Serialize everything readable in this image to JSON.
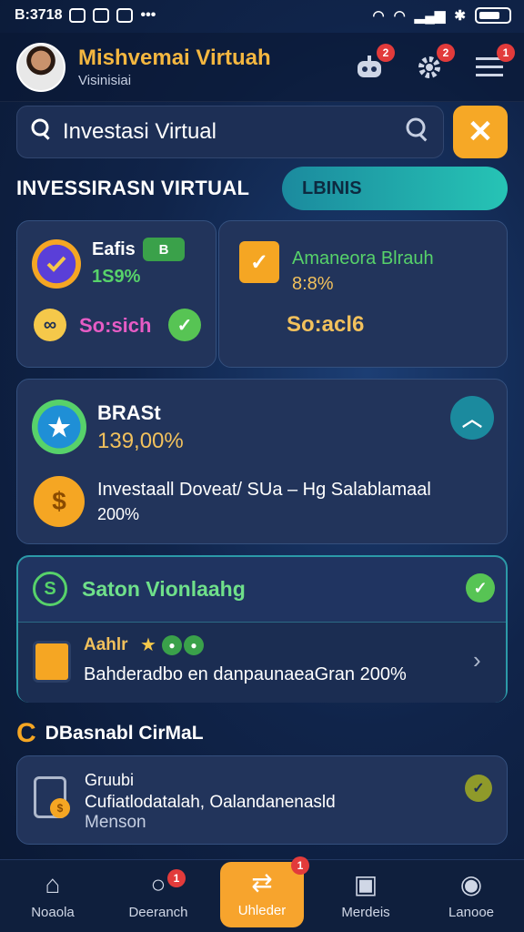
{
  "status_bar": {
    "time": "B:3718",
    "dots": "•••"
  },
  "header": {
    "title": "Mishvemai Virtuah",
    "subtitle": "Visinisiai",
    "icons": [
      {
        "name": "robot-icon",
        "badge": "2"
      },
      {
        "name": "gear-icon",
        "badge": "2"
      },
      {
        "name": "menu-icon",
        "badge": "1"
      }
    ]
  },
  "search": {
    "value": "Investasi Virtual",
    "placeholder": ""
  },
  "section_title": "INVESSIRASN VIRTUAL",
  "tab_pill": "LBINIS",
  "card_a": {
    "label": "Eafis",
    "badge": "B",
    "value": "1S9%",
    "action_label": "So:sich"
  },
  "card_b": {
    "label": "Amaneora Blrauh",
    "value": "8:8%",
    "action_label": "So:acl6"
  },
  "card_c": {
    "title": "BRASt",
    "value": "139,00%",
    "desc": "Investaall Doveat/ SUa – Hg Salablamaal",
    "desc2": "200%"
  },
  "card_d": {
    "title": "Saton Vionlaahg",
    "row_title": "Aahlr",
    "row_desc": "Bahderadbo en danpaunaeaGran 200%"
  },
  "section2": {
    "title": "DBasnabl CirMaL"
  },
  "card_e": {
    "title": "Gruubi",
    "line1": "Cufiatlodatalah, Oalandanenasld",
    "line2": "Menson"
  },
  "bottom_nav": [
    {
      "label": "Noaola",
      "icon": "home-icon"
    },
    {
      "label": "Deeranch",
      "icon": "search-icon",
      "badge": "1"
    },
    {
      "label": "Uhleder",
      "icon": "exchange-icon",
      "badge": "1",
      "active": true
    },
    {
      "label": "Merdeis",
      "icon": "chart-icon"
    },
    {
      "label": "Lanooe",
      "icon": "profile-icon"
    }
  ],
  "colors": {
    "accent_orange": "#f7a42d",
    "gold": "#f4b740",
    "teal": "#26c4b5",
    "green": "#57d26a",
    "pink": "#e65cc5"
  }
}
